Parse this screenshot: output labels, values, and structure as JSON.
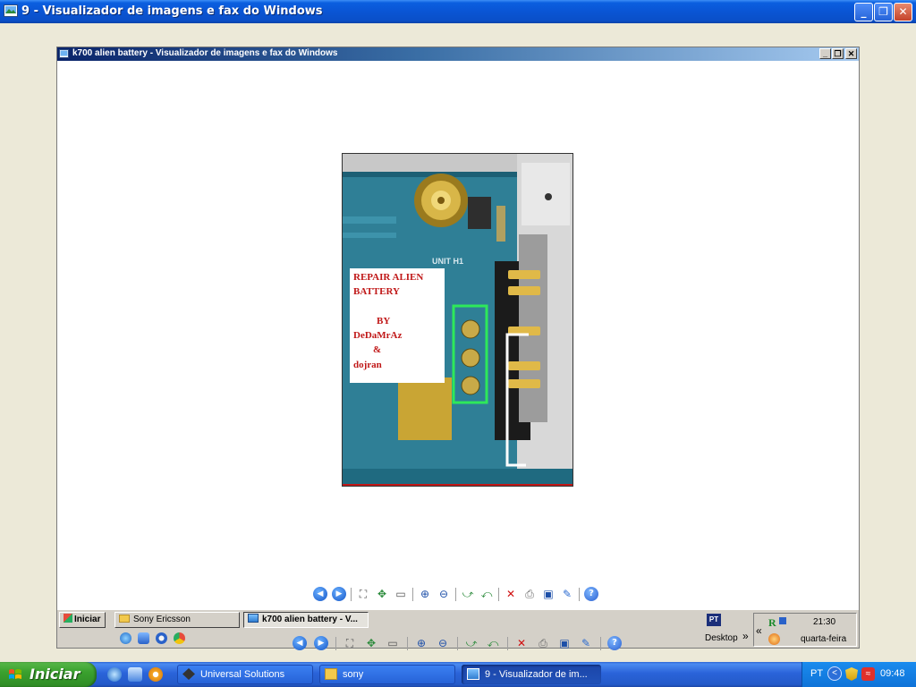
{
  "outer_window": {
    "title": "9 - Visualizador de imagens e fax do Windows",
    "min_label": "_",
    "restore_label": "❐",
    "close_label": "✕"
  },
  "inner_window": {
    "title": "k700 alien battery - Visualizador de imagens e fax do Windows",
    "min_label": "_",
    "restore_label": "❐",
    "close_label": "✕"
  },
  "photo": {
    "caption_lines": [
      "REPAIR ALIEN",
      "BATTERY",
      "BY",
      "DeDaMrAz",
      "&",
      "dojran"
    ],
    "board_label": "UNIT H1"
  },
  "toolbar_icons": [
    "previous-image-icon",
    "next-image-icon",
    "best-fit-icon",
    "actual-size-icon",
    "slideshow-icon",
    "zoom-in-icon",
    "zoom-out-icon",
    "rotate-clockwise-icon",
    "rotate-counterclockwise-icon",
    "delete-icon",
    "print-icon",
    "save-icon",
    "edit-icon",
    "help-icon"
  ],
  "inner_taskbar": {
    "start_label": "Iniciar",
    "tasks": [
      "Sony Ericsson",
      "k700 alien battery - V..."
    ],
    "lang": "PT",
    "desktop_label": "Desktop",
    "chevron": "»",
    "chevron_left": "«",
    "clock": "21:30",
    "day": "quarta-feira"
  },
  "taskbar": {
    "start_label": "Iniciar",
    "tasks": [
      "Universal Solutions",
      "sony",
      "9 - Visualizador de im..."
    ],
    "lang": "PT",
    "clock": "09:48"
  },
  "colors": {
    "xp_blue": "#0a55d4",
    "start_green": "#3aa12e",
    "highlight_green": "#2ee85a",
    "caption_red": "#c01818"
  }
}
